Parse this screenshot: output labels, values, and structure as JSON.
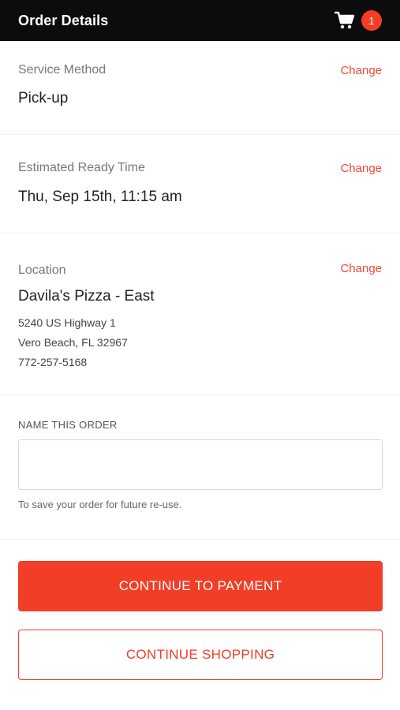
{
  "header": {
    "title": "Order Details",
    "cart_count": "1",
    "cart_icon": "cart-icon"
  },
  "service": {
    "label": "Service Method",
    "value": "Pick-up",
    "change": "Change"
  },
  "ready_time": {
    "label": "Estimated Ready Time",
    "value": "Thu, Sep 15th, 11:15 am",
    "change": "Change"
  },
  "location": {
    "label": "Location",
    "name": "Davila's Pizza - East",
    "address_line1": "5240 US Highway 1",
    "address_line2": "Vero Beach, FL 32967",
    "phone": "772-257-5168",
    "change": "Change"
  },
  "order_name": {
    "label": "NAME THIS ORDER",
    "value": "",
    "hint": "To save your order for future re-use."
  },
  "actions": {
    "continue_payment": "CONTINUE TO PAYMENT",
    "continue_shopping": "CONTINUE SHOPPING"
  },
  "colors": {
    "accent": "#f23d27",
    "header_bg": "#0c0c0c"
  }
}
